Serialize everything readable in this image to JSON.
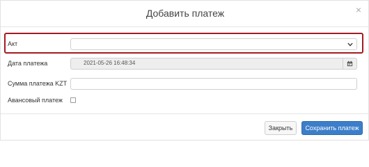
{
  "dialog": {
    "title": "Добавить платеж",
    "close_symbol": "×"
  },
  "form": {
    "act": {
      "label": "Акт",
      "value": ""
    },
    "payment_date": {
      "label": "Дата платежа",
      "value": "2021-05-26 16:48:34"
    },
    "amount": {
      "label": "Сумма платежа KZT",
      "value": ""
    },
    "advance": {
      "label": "Авансовый платеж",
      "checked": false
    }
  },
  "footer": {
    "close_label": "Закрыть",
    "save_label": "Сохранить платеж"
  },
  "colors": {
    "highlight": "#a31b22",
    "primary": "#3c7ec9"
  },
  "icons": {
    "select": "chevron-down-icon",
    "calendar": "calendar-icon"
  }
}
